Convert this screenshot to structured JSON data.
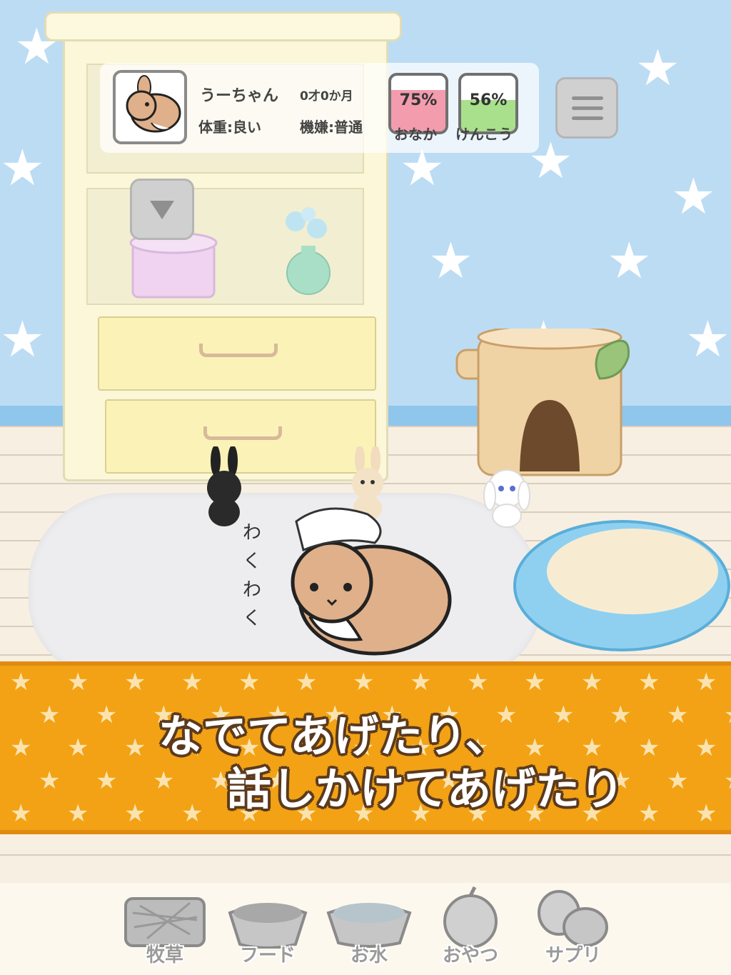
{
  "pet": {
    "name": "うーちゃん",
    "age": "0才0か月",
    "weight": "体重:良い",
    "mood": "機嫌:普通"
  },
  "gauges": [
    {
      "label": "おなか",
      "value_text": "75%",
      "value": 0.75,
      "color": "#f29cae"
    },
    {
      "label": "けんこう",
      "value_text": "56%",
      "value": 0.56,
      "color": "#a8e08c"
    }
  ],
  "icons": {
    "menu": "hamburger-menu-icon",
    "down": "triangle-down-icon"
  },
  "speech": {
    "text": "わくわく"
  },
  "banner": {
    "line1": "なでてあげたり、",
    "line2": "話しかけてあげたり",
    "color": "#f2a214"
  },
  "toolbar": {
    "items": [
      {
        "label": "牧草",
        "icon": "hay-icon"
      },
      {
        "label": "フード",
        "icon": "food-bowl-icon"
      },
      {
        "label": "お水",
        "icon": "water-bowl-icon"
      },
      {
        "label": "おやつ",
        "icon": "apple-icon"
      },
      {
        "label": "サプリ",
        "icon": "supplement-icon"
      }
    ]
  }
}
